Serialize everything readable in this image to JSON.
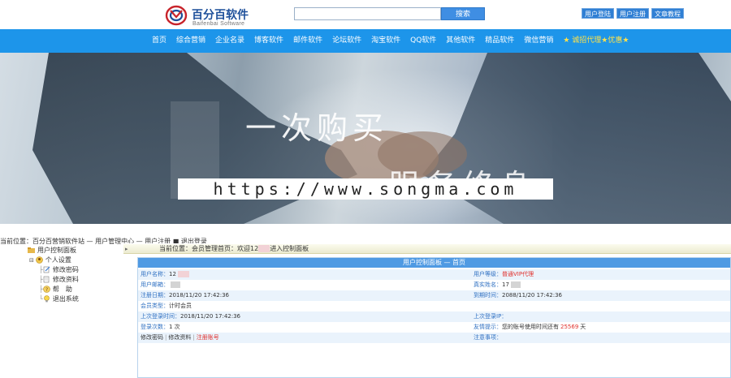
{
  "header": {
    "logo_cn": "百分百软件",
    "logo_en": "Baifenbai  Software",
    "search_value": "",
    "search_button": "搜索",
    "links": [
      "用户登陆",
      "用户注册",
      "文章教程"
    ]
  },
  "nav": {
    "items": [
      "首页",
      "综合营销",
      "企业名录",
      "博客软件",
      "邮件软件",
      "论坛软件",
      "淘宝软件",
      "QQ软件",
      "其他软件",
      "精品软件",
      "微信营销"
    ],
    "promo": "★ 诚招代理★优惠★"
  },
  "banner": {
    "slogan1": "一次购买",
    "slogan2": "服务终身",
    "watermark": "https://www.songma.com"
  },
  "breadcrumb": "当前位置：百分百营销软件站 — 用户管理中心 — 用户注册 ■ 退出登录",
  "tree": {
    "root": "用户控制面板",
    "group": "个人设置",
    "items": [
      "修改密码",
      "修改资料",
      "帮　助",
      "退出系统"
    ]
  },
  "panel": {
    "current_prefix": "当前位置：会员管理首页：欢迎",
    "current_user": "12",
    "current_suffix": "进入控制面板",
    "card_title": "用户控制面板 — 首页",
    "rows": {
      "username_label": "用户名称：",
      "username_value": "12",
      "level_label": "用户等级：",
      "level_value": "普通VIP代理",
      "email_label": "用户邮箱：",
      "realname_label": "真实姓名：",
      "realname_value": "17",
      "regtime_label": "注册日期：",
      "regtime_value": "2018/11/20 17:42:36",
      "expire_label": "到期时间：",
      "expire_value": "2088/11/20 17:42:36",
      "type_label": "会员类型：",
      "type_value": "计时会员",
      "lastlogin_label": "上次登录时间：",
      "lastlogin_value": "2018/11/20 17:42:36",
      "lastip_label": "上次登录IP：",
      "count_label": "登录次数：",
      "count_value": "1 次",
      "tip_label": "友情提示：",
      "tip_value": "您的账号使用时间还有",
      "tip_days": "25569",
      "tip_unit": "天",
      "actions": [
        "修改密码",
        "修改资料",
        "注册账号"
      ],
      "notice_label": "注意事项："
    }
  }
}
